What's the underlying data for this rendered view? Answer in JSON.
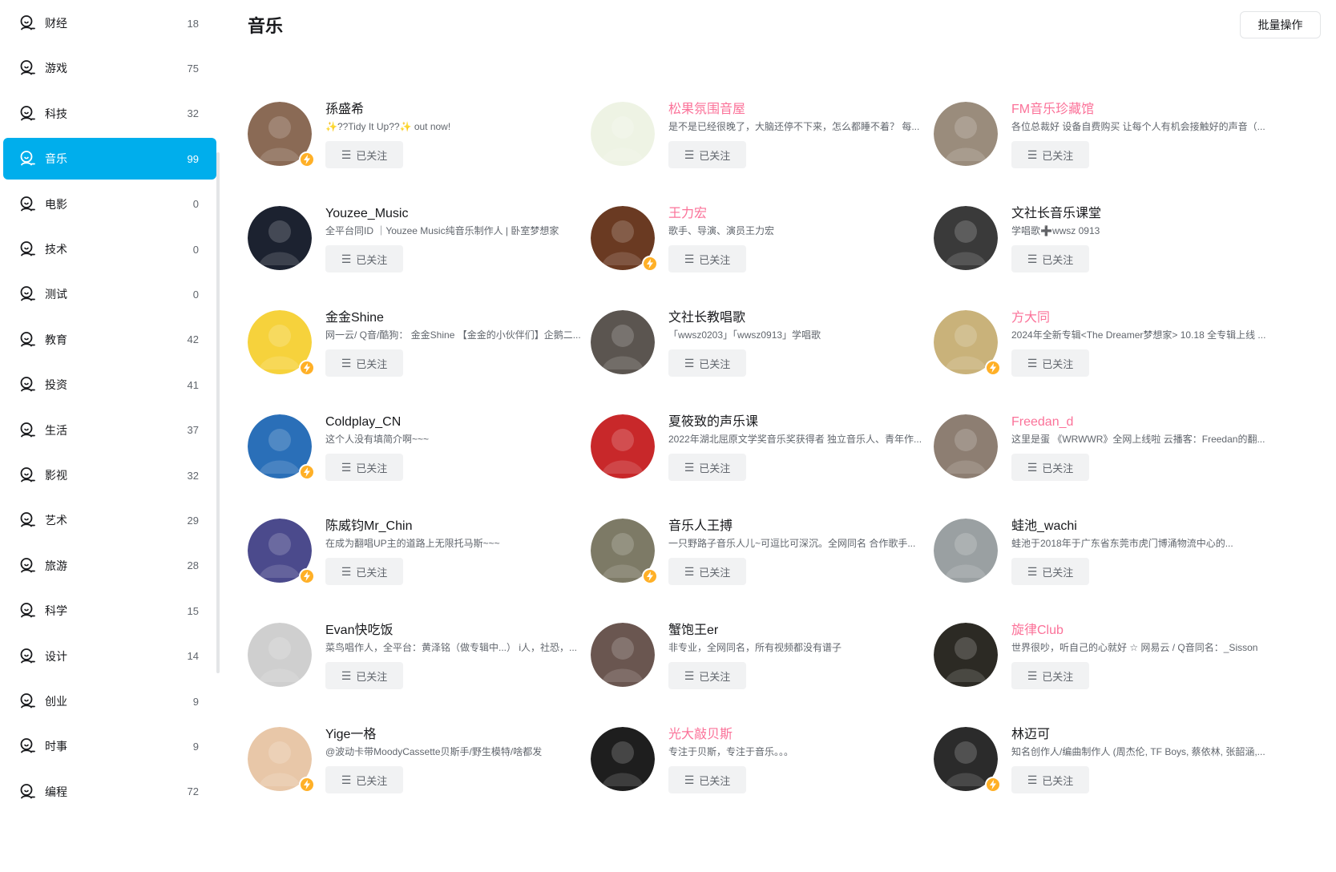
{
  "sidebar": {
    "items": [
      {
        "label": "财经",
        "count": "18",
        "active": false
      },
      {
        "label": "游戏",
        "count": "75",
        "active": false
      },
      {
        "label": "科技",
        "count": "32",
        "active": false
      },
      {
        "label": "音乐",
        "count": "99",
        "active": true
      },
      {
        "label": "电影",
        "count": "0",
        "active": false
      },
      {
        "label": "技术",
        "count": "0",
        "active": false
      },
      {
        "label": "测试",
        "count": "0",
        "active": false
      },
      {
        "label": "教育",
        "count": "42",
        "active": false
      },
      {
        "label": "投资",
        "count": "41",
        "active": false
      },
      {
        "label": "生活",
        "count": "37",
        "active": false
      },
      {
        "label": "影视",
        "count": "32",
        "active": false
      },
      {
        "label": "艺术",
        "count": "29",
        "active": false
      },
      {
        "label": "旅游",
        "count": "28",
        "active": false
      },
      {
        "label": "科学",
        "count": "15",
        "active": false
      },
      {
        "label": "设计",
        "count": "14",
        "active": false
      },
      {
        "label": "创业",
        "count": "9",
        "active": false
      },
      {
        "label": "时事",
        "count": "9",
        "active": false
      },
      {
        "label": "编程",
        "count": "72",
        "active": false
      }
    ]
  },
  "header": {
    "title": "音乐",
    "batch_label": "批量操作"
  },
  "follow_label": "已关注",
  "colors": {
    "accent": "#00aeec",
    "vip_name": "#fb7299",
    "badge": "#ffb027"
  },
  "cards": [
    {
      "name": "孫盛希",
      "vip": false,
      "desc": "✨??Tidy It Up??✨ out now!",
      "badge": true,
      "avatar_color": "#8a6a55"
    },
    {
      "name": "松果氛围音屋",
      "vip": true,
      "desc": "是不是已经很晚了，大脑还停不下来，怎么都睡不着？ 每...",
      "badge": false,
      "avatar_color": "#eef3e4"
    },
    {
      "name": "FM音乐珍藏馆",
      "vip": true,
      "desc": "各位总裁好 设备自费购买 让每个人有机会接触好的声音（...",
      "badge": false,
      "avatar_color": "#9a8c7c"
    },
    {
      "name": "Youzee_Music",
      "vip": false,
      "desc": "全平台同ID ｜Youzee Music纯音乐制作人 | 卧室梦想家",
      "badge": false,
      "avatar_color": "#1c2230"
    },
    {
      "name": "王力宏",
      "vip": true,
      "desc": "歌手、导演、演员王力宏",
      "badge": true,
      "avatar_color": "#6a3a22"
    },
    {
      "name": "文社长音乐课堂",
      "vip": false,
      "desc": "学唱歌➕wwsz 0913",
      "badge": false,
      "avatar_color": "#3a3a3a"
    },
    {
      "name": "金金Shine",
      "vip": false,
      "desc": "网一云/ Q音/酷狗： 金金Shine 【金金的小伙伴们】企鹅二...",
      "badge": true,
      "avatar_color": "#f6d23c"
    },
    {
      "name": "文社长教唱歌",
      "vip": false,
      "desc": "「wwsz0203」「wwsz0913」学唱歌",
      "badge": false,
      "avatar_color": "#5b5550"
    },
    {
      "name": "方大同",
      "vip": true,
      "desc": "2024年全新专辑<The Dreamer梦想家> 10.18 全专辑上线 ...",
      "badge": true,
      "avatar_color": "#c9b27a"
    },
    {
      "name": "Coldplay_CN",
      "vip": false,
      "desc": "这个人没有填简介啊~~~",
      "badge": true,
      "avatar_color": "#2a6fb8"
    },
    {
      "name": "夏筱致的声乐课",
      "vip": false,
      "desc": "2022年湖北屈原文学奖音乐奖获得者 独立音乐人、青年作...",
      "badge": false,
      "avatar_color": "#c8282a"
    },
    {
      "name": "Freedan_d",
      "vip": true,
      "desc": "这里是蛋 《WRWWR》全网上线啦 云播客：Freedan的翻...",
      "badge": false,
      "avatar_color": "#8d7e72"
    },
    {
      "name": "陈威钧Mr_Chin",
      "vip": false,
      "desc": "在成为翻唱UP主的道路上无限托马斯~~~",
      "badge": true,
      "avatar_color": "#4b4a8c"
    },
    {
      "name": "音乐人王搏",
      "vip": false,
      "desc": "一只野路子音乐人儿~可逗比可深沉。全网同名 合作歌手...",
      "badge": true,
      "avatar_color": "#7d7a66"
    },
    {
      "name": "蛙池_wachi",
      "vip": false,
      "desc": "蛙池于2018年于广东省东莞市虎门博涌物流中心的...",
      "badge": false,
      "avatar_color": "#9aa0a2"
    },
    {
      "name": "Evan快吃饭",
      "vip": false,
      "desc": "菜鸟唱作人，全平台：黄泽铭（做专辑中...） i人，社恐，...",
      "badge": false,
      "avatar_color": "#cfcfcf"
    },
    {
      "name": "蟹饱王er",
      "vip": false,
      "desc": "非专业，全网同名，所有视频都没有谱子",
      "badge": false,
      "avatar_color": "#6a5650"
    },
    {
      "name": "旋律Club",
      "vip": true,
      "desc": "世界很吵，听自己的心就好 ☆ 网易云 / Q音同名：_Sisson",
      "badge": false,
      "avatar_color": "#2c2a24"
    },
    {
      "name": "Yige一格",
      "vip": false,
      "desc": "@波动卡带MoodyCassette贝斯手/野生模特/啥都发",
      "badge": true,
      "avatar_color": "#e8c7a8"
    },
    {
      "name": "光大敲贝斯",
      "vip": true,
      "desc": "专注于贝斯，专注于音乐。。。",
      "badge": false,
      "avatar_color": "#1e1e1e"
    },
    {
      "name": "林迈可",
      "vip": false,
      "desc": "知名创作人/编曲制作人 (周杰伦, TF Boys, 蔡依林, 张韶涵,...",
      "badge": true,
      "avatar_color": "#2b2b2b"
    }
  ]
}
